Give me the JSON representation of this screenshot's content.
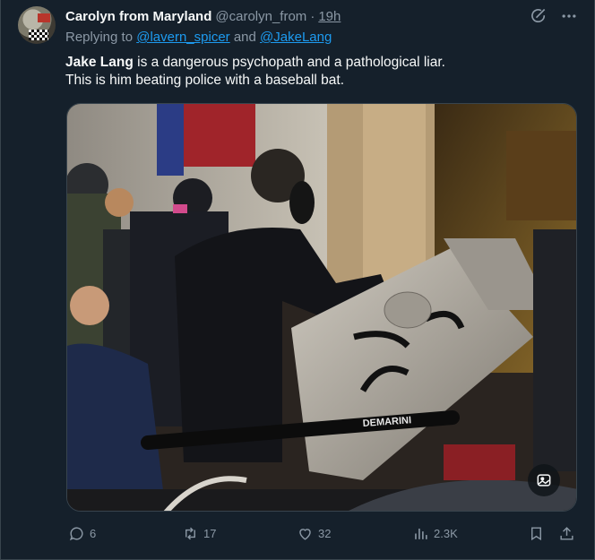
{
  "tweet": {
    "display_name": "Carolyn from Maryland",
    "handle": "@carolyn_from",
    "separator": "·",
    "time": "19h",
    "reply_prefix": "Replying to",
    "reply_to_1": "@lavern_spicer",
    "reply_and": "and",
    "reply_to_2": "@JakeLang",
    "text_bold": "Jake Lang",
    "text_line1_rest": " is a dangerous psychopath and a pathological liar.",
    "text_line2": "This is him beating police with a baseball bat.",
    "bat_text": "DEMARINI"
  },
  "actions": {
    "replies": "6",
    "retweets": "17",
    "likes": "32",
    "views": "2.3K"
  },
  "icons": {
    "grok": "grok-icon",
    "more": "more-icon",
    "reply": "reply-icon",
    "retweet": "retweet-icon",
    "like": "heart-icon",
    "views": "views-icon",
    "bookmark": "bookmark-icon",
    "share": "share-icon",
    "alt": "image-alt-icon"
  },
  "colors": {
    "background": "#15202b",
    "link": "#1d9bf0",
    "muted": "#8b98a5",
    "text": "#f7f9f9"
  }
}
